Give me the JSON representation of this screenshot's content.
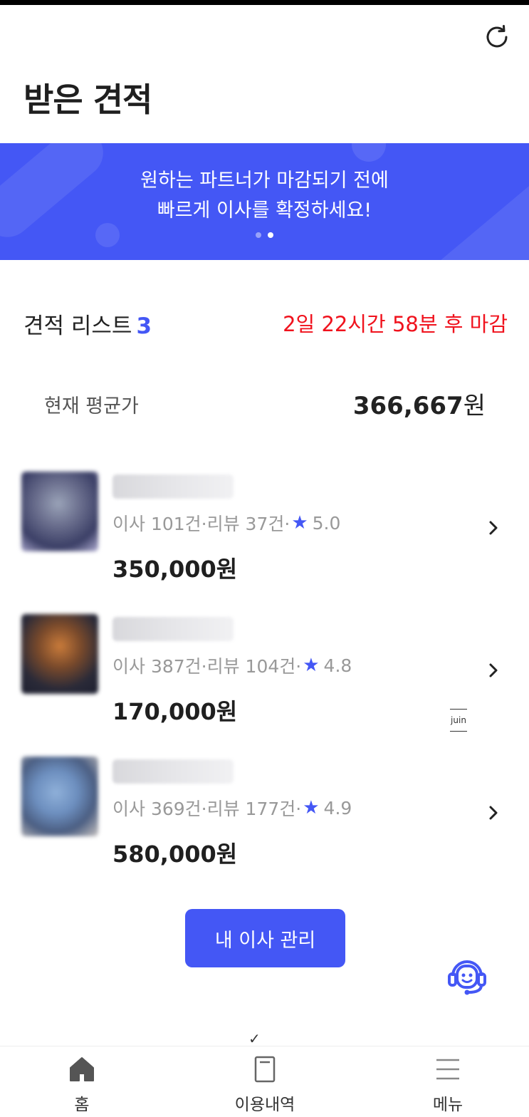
{
  "header": {
    "title": "받은 견적",
    "refresh_icon": "refresh-icon"
  },
  "banner": {
    "line1": "원하는 파트너가 마감되기 전에",
    "line2": "빠르게 이사를 확정하세요!",
    "page_count": 2,
    "active_page": 2,
    "color": "#4457f5"
  },
  "list": {
    "title": "견적 리스트",
    "count": "3",
    "deadline": "2일 22시간 58분 후 마감"
  },
  "average": {
    "label": "현재 평균가",
    "value": "366,667",
    "unit": "원"
  },
  "quotes": [
    {
      "stats_text": "이사 101건·리뷰 37건·",
      "rating": "5.0",
      "price": "350,000원"
    },
    {
      "stats_text": "이사 387건·리뷰 104건·",
      "rating": "4.8",
      "price": "170,000원"
    },
    {
      "stats_text": "이사 369건·리뷰 177건·",
      "rating": "4.9",
      "price": "580,000원"
    }
  ],
  "watermark": "juin",
  "manage_button": "내 이사 관리",
  "support_icon": "headset-support-icon",
  "bottom_nav": [
    {
      "label": "홈",
      "icon": "home-icon"
    },
    {
      "label": "이용내역",
      "icon": "history-icon"
    },
    {
      "label": "메뉴",
      "icon": "menu-icon"
    }
  ],
  "colors": {
    "accent": "#4457f5",
    "deadline": "#f0121d"
  }
}
